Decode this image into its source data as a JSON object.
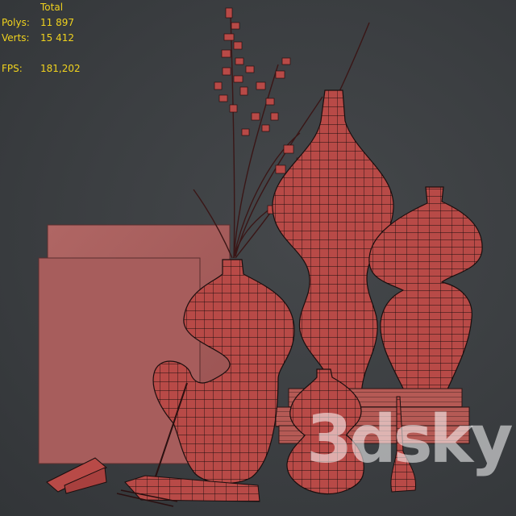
{
  "viewport_stats": {
    "header": "Total",
    "polys_label": "Polys:",
    "polys_value": "11 897",
    "verts_label": "Verts:",
    "verts_value": "15 412",
    "fps_label": "FPS:",
    "fps_value": "181,202"
  },
  "watermark": "3dsky",
  "colors": {
    "background": "#3b3e41",
    "stats_text": "#f0d21e",
    "model_fill": "#b84a47",
    "wire": "#1a0e0e",
    "panel_fill": "#a85d5d"
  }
}
